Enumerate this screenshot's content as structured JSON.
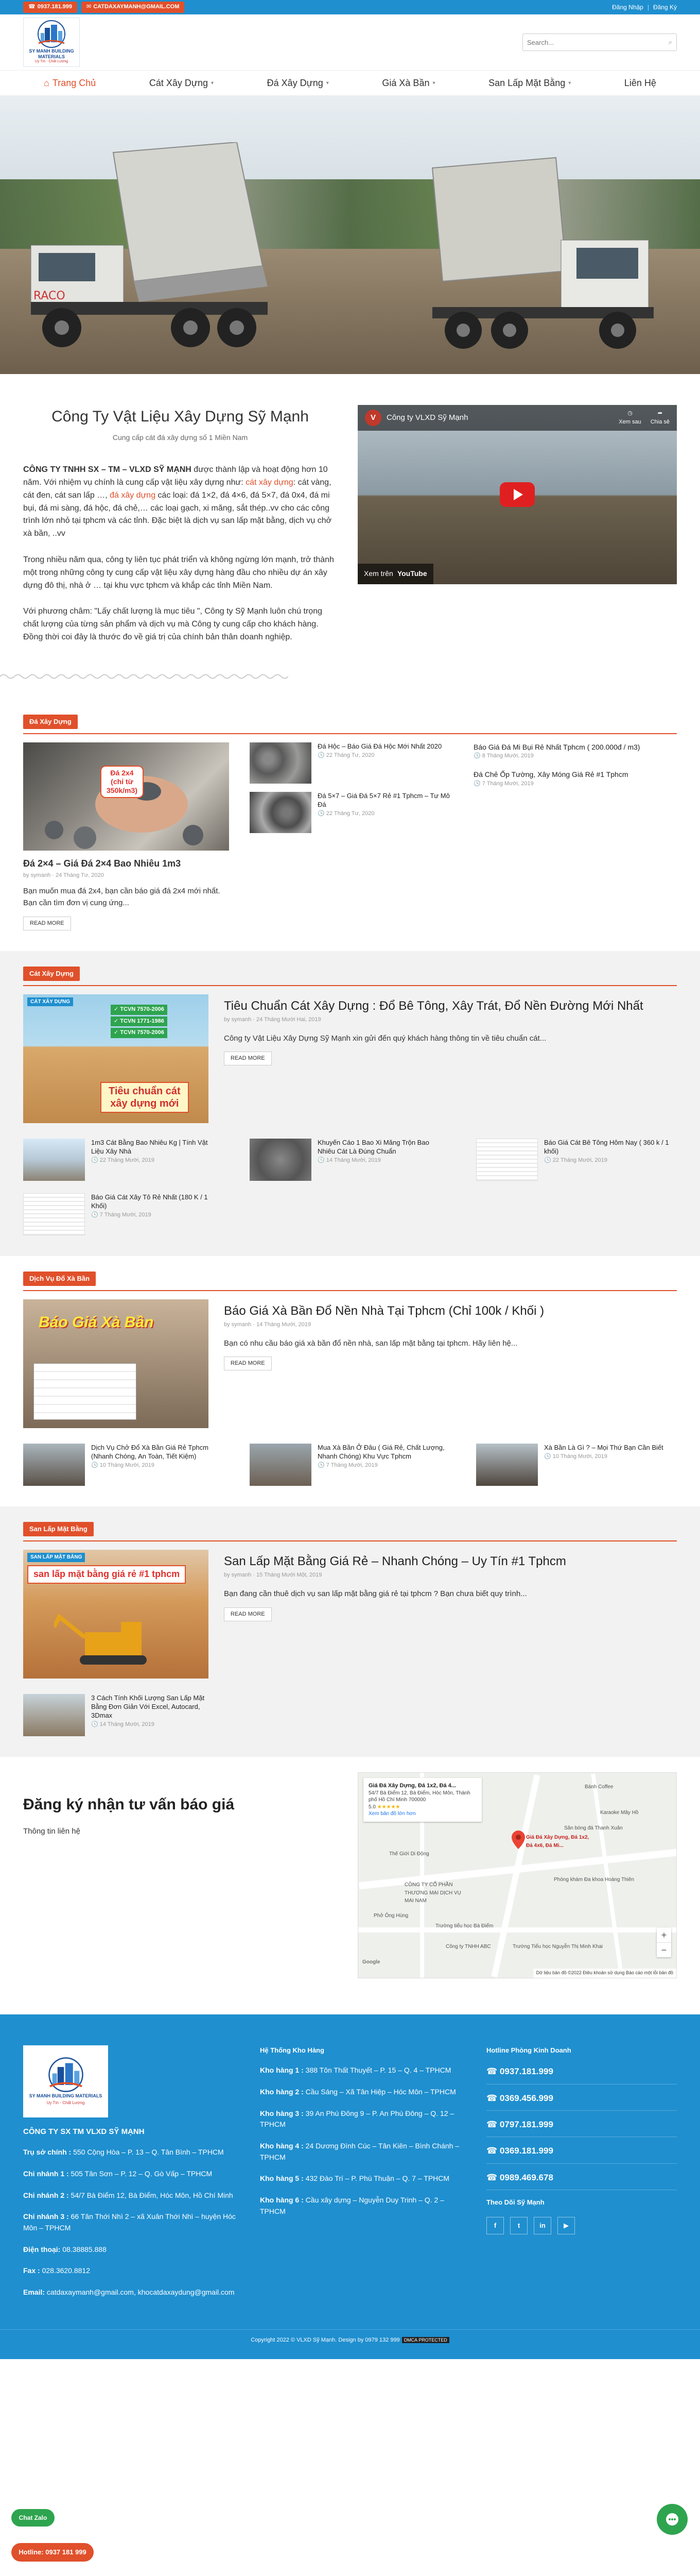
{
  "topbar": {
    "phone": "0937.181.999",
    "email": "CATDAXAYMANH@GMAIL.COM",
    "login": "Đăng Nhập",
    "register": "Đăng Ký"
  },
  "search": {
    "placeholder": "Search..."
  },
  "logo": {
    "brand": "SY MANH BUILDING MATERIALS",
    "tag": "Uy Tín - Chất Lượng"
  },
  "nav": {
    "home": "Trang Chủ",
    "items": [
      "Cát Xây Dựng",
      "Đá Xây Dựng",
      "Giá Xà Bần",
      "San Lấp Mặt Bằng",
      "Liên Hệ"
    ]
  },
  "intro": {
    "title": "Công Ty Vật Liệu Xây Dựng Sỹ Mạnh",
    "subtitle": "Cung cấp cát đá xây dựng số 1 Miền Nam",
    "p1_company": "CÔNG TY TNHH SX – TM – VLXD SỸ MẠNH",
    "p1_a": " được thành lập và hoạt động hơn 10 năm. Với nhiệm vụ chính là cung cấp vật liệu xây dựng như: ",
    "p1_link1": "cát xây dựng",
    "p1_b": ": cát vàng, cát đen, cát san lấp …, ",
    "p1_link2": "đá xây dựng",
    "p1_c": " các loại: đá 1×2, đá 4×6, đá 5×7, đá 0x4, đá mi bụi, đá mi sàng, đá hộc, đá chẻ,… các loại gạch, xi măng, sắt thép..vv cho các công trình lớn nhỏ tại tphcm và các tỉnh. Đặc biệt là dịch vụ san lấp mặt bằng, dịch vụ chở xà bần, ..vv",
    "p2": "Trong nhiều năm qua, công ty liên tục phát triển và không ngừng lớn mạnh, trở thành một trong những công ty cung cấp vật liệu xây dựng hàng đầu cho nhiều dự án xây dựng đô thị, nhà ở … tại khu vực tphcm và khắp các tỉnh Miền Nam.",
    "p3": "Với phương châm: \"Lấy chất lượng là mục tiêu \", Công ty Sỹ Mạnh luôn chú trọng chất lượng của từng sản phẩm và dịch vụ mà Công ty cung cấp cho khách hàng. Đồng thời coi đây là thước đo về giá trị của chính bản thân doanh nghiệp."
  },
  "video": {
    "channel_initial": "V",
    "title": "Công ty VLXD Sỹ Mạnh",
    "watch_later": "Xem sau",
    "share": "Chia sẻ",
    "watch_on": "Xem trên",
    "youtube": "YouTube"
  },
  "sec_da": {
    "label": "Đá Xây Dựng",
    "big_title": "Đá 2×4 – Giá Đá 2×4 Bao Nhiêu 1m3",
    "big_meta": "by symanh · 24 Tháng Tư, 2020",
    "big_excerpt": "Bạn muốn mua đá 2x4, bạn cần báo giá đá 2x4 mới nhất. Bạn cần tìm đơn vị cung ứng...",
    "readmore": "READ MORE",
    "big_overlay1": "Đá 2x4",
    "big_overlay2": "(chỉ từ",
    "big_overlay3": "350k/m3)",
    "mid": [
      {
        "title": "Đá Hộc – Báo Giá Đá Hộc Mới Nhất 2020",
        "meta": "22 Tháng Tư, 2020"
      },
      {
        "title": "Đá 5×7 – Giá Đá 5×7 Rẻ #1 Tphcm – Tư Mô Đá",
        "meta": "22 Tháng Tư, 2020"
      }
    ],
    "right": [
      {
        "title": "Báo Giá Đá Mi Bụi Rẻ Nhất Tphcm ( 200.000đ / m3)",
        "meta": "8 Tháng Mười, 2019"
      },
      {
        "title": "Đá Chẻ Ốp Tường, Xây Móng Giá Rẻ #1 Tphcm",
        "meta": "7 Tháng Mười, 2019"
      }
    ]
  },
  "sec_cat": {
    "label": "Cát Xây Dựng",
    "title": "Tiêu Chuẩn Cát Xây Dựng : Đổ Bê Tông, Xây Trát, Đổ Nền Đường Mới Nhất",
    "meta": "by symanh · 24 Tháng Mười Hai, 2019",
    "excerpt": "Công ty Vật Liệu Xây Dựng Sỹ Mạnh xin gửi đến quý khách hàng thông tin về tiêu chuẩn cát...",
    "readmore": "READ MORE",
    "img_tag": "CÁT XÂY DỰNG",
    "img_tcvn": [
      "TCVN 7570-2006",
      "TCVN 1771-1986",
      "TCVN 7570-2006"
    ],
    "img_caption1": "Tiêu chuẩn cát",
    "img_caption2": "xây dựng mới",
    "items": [
      {
        "title": "1m3 Cát Bằng Bao Nhiêu Kg | Tính Vật Liệu Xây Nhà",
        "meta": "22 Tháng Mười, 2019"
      },
      {
        "title": "Khuyến Cáo 1 Bao Xi Măng Trộn Bao Nhiêu Cát Là Đúng Chuẩn",
        "meta": "14 Tháng Mười, 2019"
      },
      {
        "title": "Báo Giá Cát Bê Tông Hôm Nay ( 360 k / 1 khối)",
        "meta": "22 Tháng Mười, 2019"
      },
      {
        "title": "Báo Giá Cát Xây Tô Rẻ Nhất (180 K / 1 Khối)",
        "meta": "7 Tháng Mười, 2019"
      }
    ]
  },
  "sec_xb": {
    "label": "Dịch Vụ Đổ Xà Bần",
    "title": "Báo Giá Xà Bần Đổ Nền Nhà Tại Tphcm (Chỉ 100k / Khối )",
    "meta": "by symanh · 14 Tháng Mười, 2019",
    "excerpt": "Bạn có nhu cầu báo giá xà bần đổ nền nhà, san lấp mặt bằng tại tphcm. Hãy liên hệ...",
    "readmore": "READ MORE",
    "img_caption": "Báo Giá Xà Bần",
    "items": [
      {
        "title": "Dịch Vụ Chở Đổ Xà Bần Giá Rẻ Tphcm (Nhanh Chóng, An Toàn, Tiết Kiệm)",
        "meta": "10 Tháng Mười, 2019"
      },
      {
        "title": "Mua Xà Bần Ở Đâu ( Giá Rẻ, Chất Lượng, Nhanh Chóng) Khu Vực Tphcm",
        "meta": "7 Tháng Mười, 2019"
      },
      {
        "title": "Xà Bần Là Gì ? – Mọi Thứ Bạn Cần Biết",
        "meta": "10 Tháng Mười, 2019"
      }
    ]
  },
  "sec_sl": {
    "label": "San Lấp Mặt Bằng",
    "title": "San Lấp Mặt Bằng Giá Rẻ – Nhanh Chóng – Uy Tín #1 Tphcm",
    "meta": "by symanh · 15 Tháng Mười Một, 2019",
    "excerpt": "Bạn đang cần thuê dịch vụ san lấp mặt bằng giá rẻ tại tphcm ? Bạn chưa biết quy trình...",
    "readmore": "READ MORE",
    "img_tag": "SAN LẤP MẶT BẰNG",
    "img_caption": "san lấp mặt bằng giá rẻ #1 tphcm",
    "items": [
      {
        "title": "3 Cách Tính Khối Lượng San Lấp Mặt Bằng Đơn Giản Với Excel, Autocard, 3Dmax",
        "meta": "14 Tháng Mười, 2019"
      }
    ]
  },
  "newsletter": {
    "title": "Đăng ký nhận tư vấn báo giá",
    "label": "Thông tin liên hệ"
  },
  "map": {
    "name": "Giá Đá Xây Dựng, Đá 1x2, Đá 4...",
    "address": "54/7 Bà Điểm 12, Bà Điểm, Hóc Môn, Thành phố Hồ Chí Minh 700000",
    "rating": "5.0",
    "stars": "★★★★★",
    "larger": "Xem bản đồ lớn hơn",
    "pin_label": "Giá Đá Xây Dựng, Đá 1x2, Đá 4x6, Đá Mi...",
    "footer": "Dữ liệu bản đồ ©2022   Điều khoản sử dụng   Báo cáo một lỗi bản đồ",
    "labels": [
      "Bánh Coffee",
      "Karaoke Mây Hồ",
      "Sân bóng đá Thanh Xuân",
      "Thế Giới Di Động",
      "CÔNG TY CỔ PHẦN THƯƠNG MẠI DỊCH VỤ MAI NAM",
      "Phở Ông Hùng",
      "Trường tiểu học Bà Điểm",
      "Phòng khám Đa khoa Hoàng Thiên",
      "Trường Tiểu học Nguyễn Thị Minh Khai",
      "Công ty TNHH ABC",
      "Google"
    ]
  },
  "footer": {
    "company": "CÔNG TY SX TM VLXD SỸ MẠNH",
    "lines": [
      {
        "label": "Trụ sở chính :",
        "value": " 550 Cộng Hòa – P. 13 – Q. Tân Bình – TPHCM"
      },
      {
        "label": "Chi nhánh 1 :",
        "value": " 505 Tân Sơn – P. 12 – Q. Gò Vấp – TPHCM"
      },
      {
        "label": "Chi nhánh 2 :",
        "value": " 54/7 Bà Điểm 12, Bà Điểm, Hóc Môn, Hồ Chí Minh"
      },
      {
        "label": "Chi nhánh 3 :",
        "value": " 66 Tân Thới Nhì 2 – xã Xuân Thới Nhì – huyện Hóc Môn – TPHCM"
      },
      {
        "label": "Điện thoại:",
        "value": " 08.38885.888"
      },
      {
        "label": "Fax :",
        "value": " 028.3620.8812"
      },
      {
        "label": "Email:",
        "value": " catdaxaymanh@gmail.com, khocatdaxaydung@gmail.com"
      }
    ],
    "warehouse_title": "Hệ Thống Kho Hàng",
    "warehouses": [
      {
        "label": "Kho hàng 1 :",
        "value": " 388 Tôn Thất Thuyết – P. 15 – Q. 4 – TPHCM"
      },
      {
        "label": "Kho hàng 2 :",
        "value": " Cầu Sáng – Xã Tân Hiệp – Hóc Môn – TPHCM"
      },
      {
        "label": "Kho hàng 3 :",
        "value": " 39 An Phú Đông 9 – P. An Phú Đông – Q. 12 – TPHCM"
      },
      {
        "label": "Kho hàng 4 :",
        "value": " 24 Dương Đình Cúc – Tân Kiên – Bình Chánh – TPHCM"
      },
      {
        "label": "Kho hàng 5 :",
        "value": " 432 Đào Trí – P. Phú Thuận – Q. 7 – TPHCM"
      },
      {
        "label": "Kho hàng 6 :",
        "value": " Cầu xây dựng – Nguyễn Duy Trinh – Q. 2 – TPHCM"
      }
    ],
    "hotline_title": "Hotline Phòng Kinh Doanh",
    "hotlines": [
      "0937.181.999",
      "0369.456.999",
      "0797.181.999",
      "0369.181.999",
      "0989.469.678"
    ],
    "follow_title": "Theo Dõi Sỹ Mạnh",
    "social": [
      "f",
      "t",
      "in",
      "▶"
    ],
    "copyright": "Copyright 2022 © VLXD Sỹ Mạnh. Design by 0979 132 999",
    "dmca": "DMCA PROTECTED"
  },
  "floating": {
    "chat_zalo": "Chat Zalo",
    "hotline": "Hotline: 0937 181 999"
  }
}
